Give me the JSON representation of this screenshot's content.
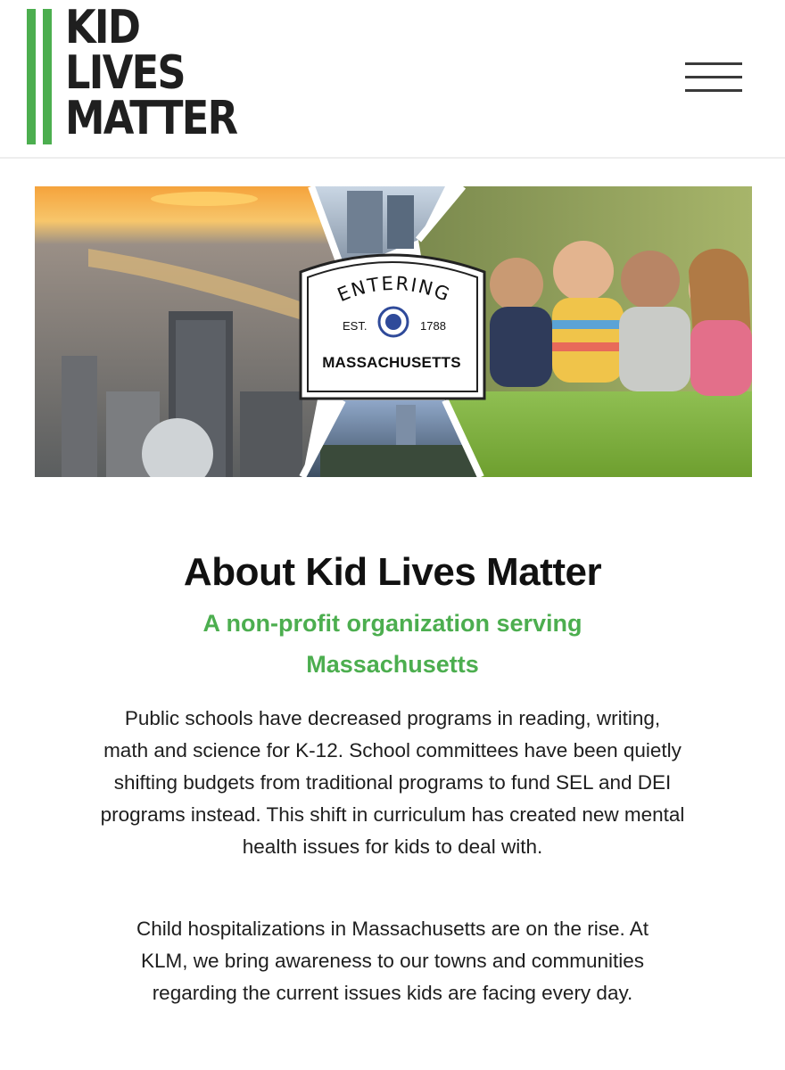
{
  "logo": {
    "line1": "KID",
    "line2": "LIVES",
    "line3": "MATTER"
  },
  "header": {
    "menu_icon": "hamburger-menu-icon"
  },
  "hero": {
    "sign": {
      "entering": "ENTERING",
      "est": "EST.",
      "year": "1788",
      "state": "MASSACHUSETTS",
      "seal_icon": "massachusetts-seal-icon"
    }
  },
  "about": {
    "title": "About Kid Lives Matter",
    "subtitle": "A non-profit organization serving Massachusetts",
    "paragraph1": "Public schools have decreased programs in reading, writing, math and science for K-12.  School committees have been quietly shifting budgets from traditional programs to fund SEL and DEI programs instead. This shift in curriculum has created new mental health issues for kids to deal with.",
    "paragraph2": "Child hospitalizations in Massachusetts are on the rise. At KLM, we bring awareness to our towns and communities regarding the current issues kids are facing every day."
  },
  "colors": {
    "brand_green": "#4cae4f",
    "text_dark": "#111111"
  }
}
